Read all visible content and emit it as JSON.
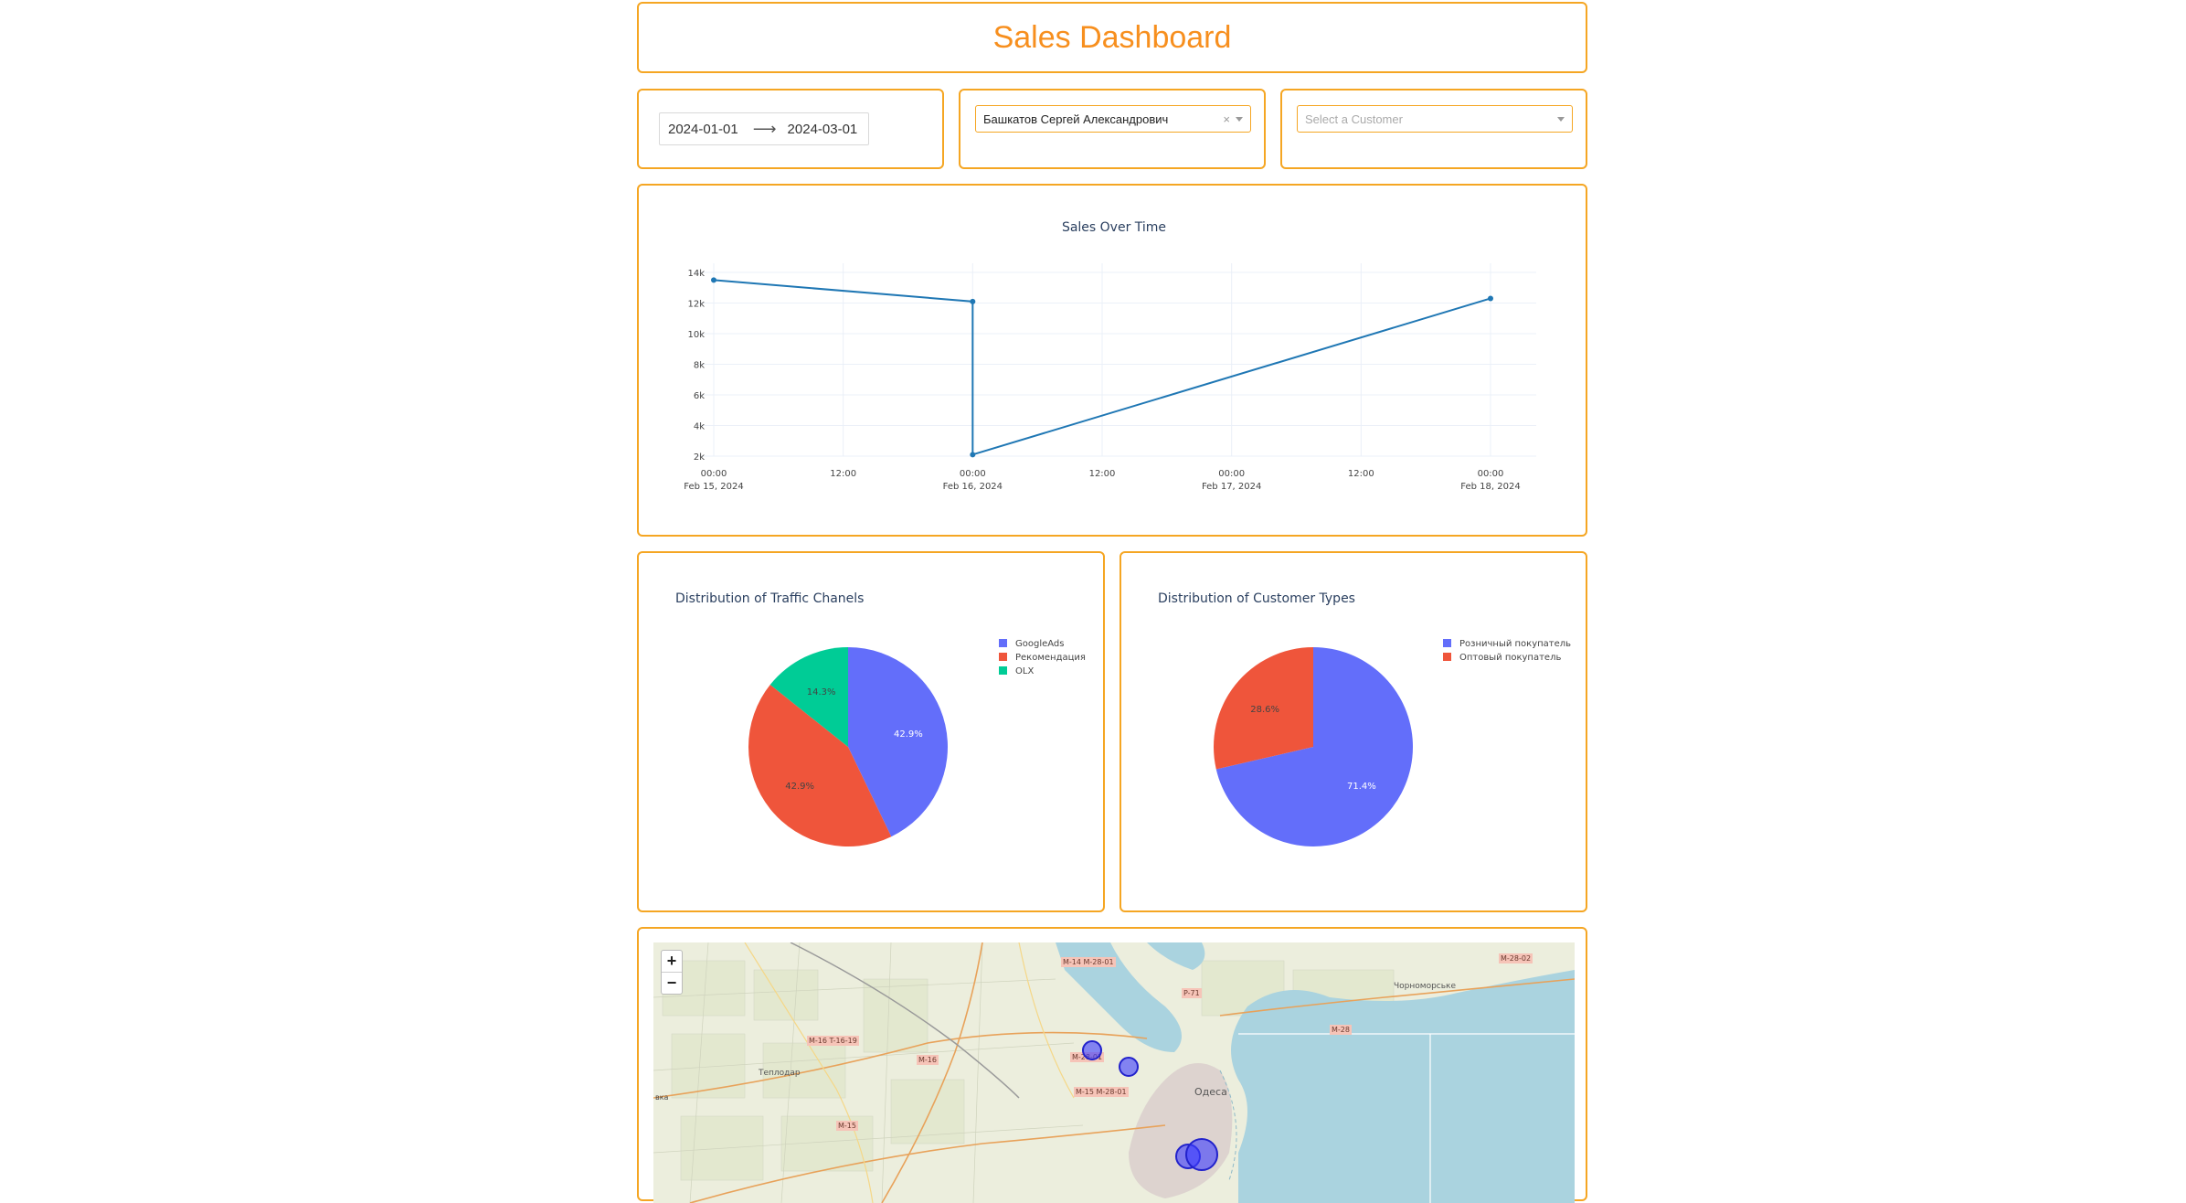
{
  "header": {
    "title": "Sales Dashboard"
  },
  "filters": {
    "date_start": "2024-01-01",
    "date_end": "2024-03-01",
    "employee_value": "Башкатов Сергей Александрович",
    "employee_clear": "×",
    "customer_placeholder": "Select a Customer"
  },
  "colors": {
    "accent": "#f5a623",
    "title": "#f78f1e",
    "line": "#1f77b4",
    "pie_blue": "#636efa",
    "pie_red": "#ef553b",
    "pie_green": "#00cc96",
    "map_marker": "#3333ff"
  },
  "chart_data": [
    {
      "type": "line",
      "title": "Sales Over Time",
      "x": [
        "2024-02-15 00:00",
        "2024-02-16 00:00",
        "2024-02-16 00:00",
        "2024-02-18 00:00"
      ],
      "y": [
        13500,
        12100,
        2100,
        12300
      ],
      "ylim": [
        2000,
        14000
      ],
      "yticks": [
        "2k",
        "4k",
        "6k",
        "8k",
        "10k",
        "12k",
        "14k"
      ],
      "xticks": [
        [
          "00:00",
          "Feb 15, 2024"
        ],
        [
          "12:00",
          ""
        ],
        [
          "00:00",
          "Feb 16, 2024"
        ],
        [
          "12:00",
          ""
        ],
        [
          "00:00",
          "Feb 17, 2024"
        ],
        [
          "12:00",
          ""
        ],
        [
          "00:00",
          "Feb 18, 2024"
        ]
      ],
      "grid": true
    },
    {
      "type": "pie",
      "title": "Distribution of Traffic Chanels",
      "labels": [
        "GoogleAds",
        "Рекомендация",
        "OLX"
      ],
      "values": [
        42.9,
        42.9,
        14.3
      ],
      "text": [
        "42.9%",
        "42.9%",
        "14.3%"
      ],
      "legend": "top-right"
    },
    {
      "type": "pie",
      "title": "Distribution of Customer Types",
      "labels": [
        "Розничный покупатель",
        "Оптовый покупатель"
      ],
      "values": [
        71.4,
        28.6
      ],
      "text": [
        "71.4%",
        "28.6%"
      ],
      "legend": "top-right"
    }
  ],
  "map": {
    "zoom_in": "+",
    "zoom_out": "−",
    "labels": [
      "Чорноморське",
      "Теплодар",
      "Одеса"
    ],
    "road_labels": [
      "M-14 M-28-01",
      "M-28-02",
      "P-71",
      "M-28",
      "M-16 T-16-19",
      "M-28-01",
      "M-16",
      "M-15 M-28-01",
      "M-15",
      "вка"
    ]
  }
}
